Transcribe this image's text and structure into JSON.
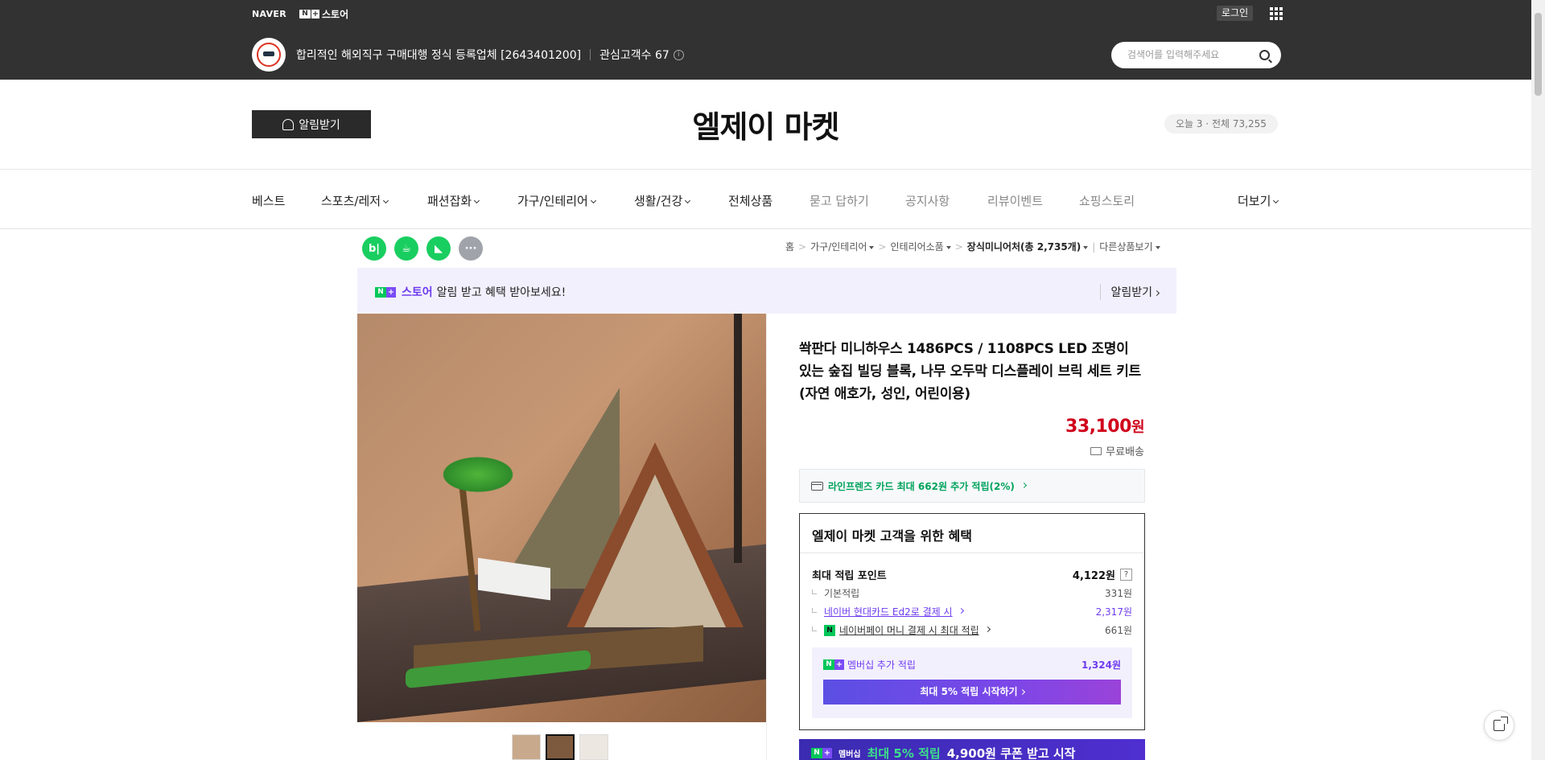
{
  "topbar": {
    "naver_logo": "NAVER",
    "store_brand": "스토어",
    "login": "로그인",
    "store_desc": "합리적인 해외직구 구매대행 정식 등록업체 [2643401200]",
    "interest_label": "관심고객수 67",
    "info_icon": "ⓘ",
    "search_placeholder": "검색어를 입력해주세요"
  },
  "header": {
    "notify_label": "알림받기",
    "store_title": "엘제이 마켓",
    "visitors": "오늘 3 · 전체 73,255"
  },
  "nav": {
    "items": [
      {
        "label": "베스트"
      },
      {
        "label": "스포츠/레저"
      },
      {
        "label": "패션잡화"
      },
      {
        "label": "가구/인테리어"
      },
      {
        "label": "생활/건강"
      },
      {
        "label": "전체상품"
      },
      {
        "label": "묻고 답하기"
      },
      {
        "label": "공지사항"
      },
      {
        "label": "리뷰이벤트"
      },
      {
        "label": "쇼핑스토리"
      }
    ],
    "more": "더보기"
  },
  "share": {
    "blog": "b|",
    "cafe": "☕",
    "bookmark": "◣",
    "more": "···"
  },
  "breadcrumb": {
    "home": "홈",
    "c1": "가구/인테리어",
    "c2": "인테리어소품",
    "c3": "장식미니어처(총 2,735개)",
    "other": "다른상품보기"
  },
  "promo": {
    "store_word": "스토어",
    "text": "알림 받고 혜택 받아보세요!",
    "action": "알림받기"
  },
  "product": {
    "title": "쏵판다 미니하우스 1486PCS / 1108PCS LED 조명이 있는 숲집 빌딩 블록, 나무 오두막 디스플레이 브릭 세트 키트 (자연 애호가, 성인, 어린이용)",
    "price": "33,100",
    "currency": "원",
    "shipping": "무료배송",
    "card_benefit": "라인프렌즈 카드 최대 662원 추가 적립(2%)"
  },
  "benefit": {
    "title": "엘제이 마켓 고객을 위한 혜택",
    "max_label": "최대 적립 포인트",
    "max_value": "4,122원",
    "help": "?",
    "rows": [
      {
        "label": "기본적립",
        "value": "331원"
      },
      {
        "label": "네이버 현대카드 Ed2로 결제 시",
        "value": "2,317원"
      },
      {
        "label": "네이버페이 머니 결제 시 최대 적립",
        "value": "661원"
      }
    ],
    "npay_badge": "N",
    "member_label": "멤버십 추가 적립",
    "member_value": "1,324원",
    "member_button": "최대 5% 적립 시작하기"
  },
  "bottom_banner": {
    "badge": "멤버십",
    "highlight": "최대 5% 적립",
    "text": "4,900원 쿠폰 받고 시작"
  },
  "colors": {
    "topbar": "#323232",
    "price_red": "#d0021b",
    "naver_green": "#03c75a",
    "plus_purple": "#6e3cf0"
  }
}
